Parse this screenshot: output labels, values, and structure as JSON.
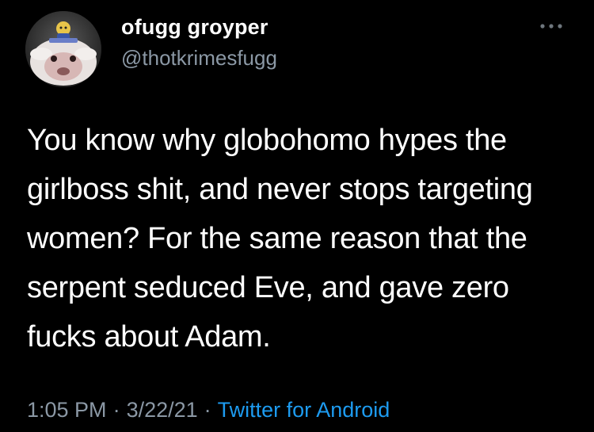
{
  "tweet": {
    "author": {
      "display_name": "ofugg groyper",
      "handle": "@thotkrimesfugg",
      "avatar_icon": "avatar-image"
    },
    "more_icon": "more-options-icon",
    "text": "You know why globohomo hypes the\ngirlboss shit, and never stops targeting\nwomen? For the same reason that the\nserpent seduced Eve, and gave zero\nfucks about Adam.",
    "time": "1:05 PM",
    "separator": "·",
    "date": "3/22/21",
    "source": "Twitter for Android"
  },
  "colors": {
    "background": "#000000",
    "primary_text": "#ffffff",
    "secondary_text": "#8b98a5",
    "link": "#1d9bf0"
  }
}
